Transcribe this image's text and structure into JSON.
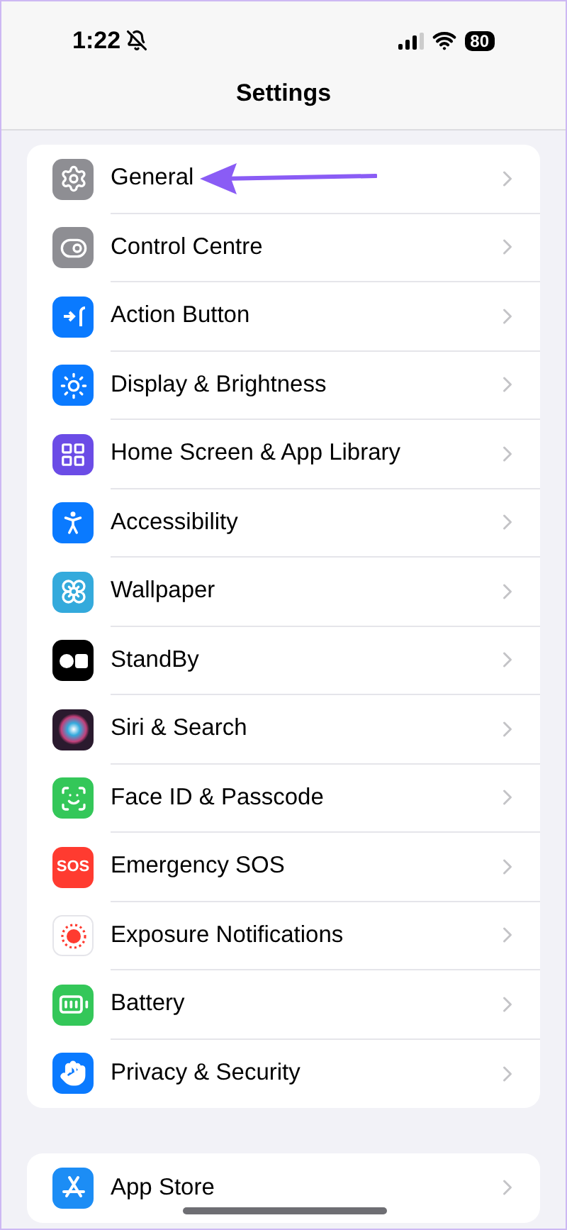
{
  "status_bar": {
    "time": "1:22",
    "battery": "80"
  },
  "title": "Settings",
  "groups": [
    {
      "items": [
        {
          "label": "General"
        },
        {
          "label": "Control Centre"
        },
        {
          "label": "Action Button"
        },
        {
          "label": "Display & Brightness"
        },
        {
          "label": "Home Screen & App Library"
        },
        {
          "label": "Accessibility"
        },
        {
          "label": "Wallpaper"
        },
        {
          "label": "StandBy"
        },
        {
          "label": "Siri & Search"
        },
        {
          "label": "Face ID & Passcode"
        },
        {
          "label": "Emergency SOS",
          "icon_text": "SOS"
        },
        {
          "label": "Exposure Notifications"
        },
        {
          "label": "Battery"
        },
        {
          "label": "Privacy & Security"
        }
      ]
    },
    {
      "items": [
        {
          "label": "App Store"
        }
      ]
    }
  ]
}
